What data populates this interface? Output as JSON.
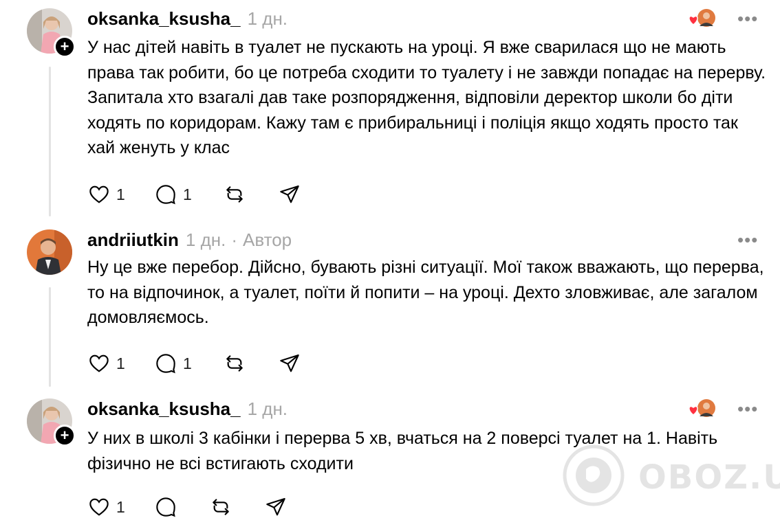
{
  "comments": [
    {
      "username": "oksanka_ksusha_",
      "time": "1 дн.",
      "text": "У нас дітей навіть в туалет не пускають на уроці. Я вже сварилася що не мають права так робити, бо це потреба сходити то туалету і не завжди попадає на перерву. Запитала хто взагалі дав таке розпорядження, відповіли деректор школи бо діти ходять по коридорам. Кажу там є прибиральниці і поліція якщо ходять просто так хай женуть у клас",
      "likes": "1",
      "replies": "1",
      "more": "•••",
      "follow_badge": "+"
    },
    {
      "username": "andriiutkin",
      "time": "1 дн.",
      "separator": "·",
      "role": "Автор",
      "text": "Ну це вже перебор. Дійсно, бувають різні ситуації. Мої також вважають, що перерва, то на відпочинок, а туалет, поїти й попити – на уроці. Дехто зловживає, але загалом домовляємось.",
      "likes": "1",
      "replies": "1",
      "more": "•••"
    },
    {
      "username": "oksanka_ksusha_",
      "time": "1 дн.",
      "text": "У них в школі 3 кабінки і перерва 5 хв, вчаться на 2 поверсі туалет на 1. Навіть фізично не всі встигають сходити",
      "likes": "1",
      "replies": "",
      "more": "•••",
      "follow_badge": "+"
    }
  ],
  "watermark": "OBOZ.UA",
  "colors": {
    "heart": "#ff3040",
    "muted": "#a6a6a6",
    "thread_line": "#e3e3e3"
  }
}
